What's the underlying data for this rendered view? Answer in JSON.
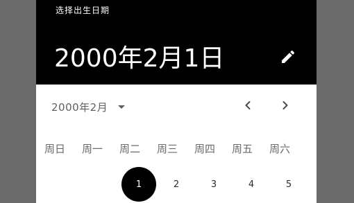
{
  "header": {
    "supporting_text": "选择出生日期",
    "headline": "2000年2月1日",
    "edit_icon": "pencil-icon"
  },
  "controls": {
    "month_year_label": "2000年2月",
    "dropdown_icon": "arrow-drop-down-icon",
    "prev_icon": "chevron-left-icon",
    "next_icon": "chevron-right-icon"
  },
  "weekdays": [
    "周日",
    "周一",
    "周二",
    "周三",
    "周四",
    "周五",
    "周六"
  ],
  "days": {
    "first_row": [
      "1",
      "2",
      "3",
      "4",
      "5"
    ],
    "selected": "1"
  },
  "colors": {
    "header_bg": "#000000",
    "scrim": "#6b6b6b",
    "selected_day_bg": "#000000",
    "selected_day_fg": "#ffffff"
  }
}
